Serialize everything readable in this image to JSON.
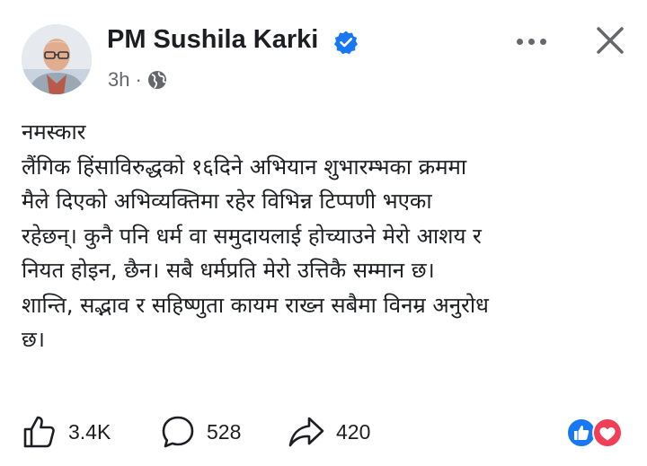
{
  "header": {
    "author_name": "PM Sushila Karki",
    "time_ago": "3h",
    "separator": "·"
  },
  "icons": {
    "avatar": "profile-photo",
    "verified": "verified-badge-icon",
    "privacy": "globe-icon",
    "more": "more-options-icon",
    "close": "close-icon",
    "like": "like-icon",
    "comment": "comment-icon",
    "share": "share-icon",
    "reaction_like": "like-reaction-icon",
    "reaction_love": "love-reaction-icon"
  },
  "colors": {
    "verified_blue": "#1877f2",
    "love_red": "#f33e58",
    "secondary_text": "#65676b"
  },
  "post": {
    "lines": [
      "नमस्कार",
      "लैंगिक हिंसाविरुद्धको १६दिने अभियान शुभारम्भका क्रममा",
      "मैले दिएको अभिव्यक्तिमा रहेर विभिन्न टिप्पणी भएका",
      "रहेछन्। कुनै पनि धर्म वा समुदायलाई होच्याउने मेरो आशय र",
      "नियत होइन, छैन। सबै धर्मप्रति मेरो उत्तिकै सम्मान छ।",
      "शान्ति, सद्भाव र सहिष्णुता कायम राख्न सबैमा विनम्र अनुरोध",
      "छ।"
    ]
  },
  "actions": {
    "likes": "3.4K",
    "comments": "528",
    "shares": "420"
  }
}
